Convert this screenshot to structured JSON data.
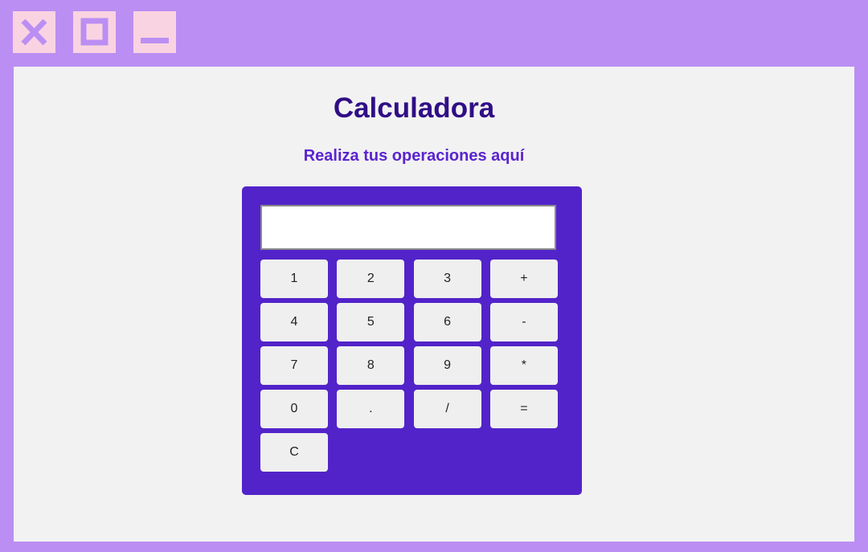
{
  "window": {
    "controls": [
      {
        "name": "close-button",
        "icon": "close-icon"
      },
      {
        "name": "maximize-button",
        "icon": "maximize-icon"
      },
      {
        "name": "minimize-button",
        "icon": "minimize-icon"
      }
    ]
  },
  "page": {
    "title": "Calculadora",
    "subtitle": "Realiza tus operaciones aquí"
  },
  "calculator": {
    "display_value": "",
    "keys": [
      "1",
      "2",
      "3",
      "+",
      "4",
      "5",
      "6",
      "-",
      "7",
      "8",
      "9",
      "*",
      "0",
      ".",
      "/",
      "=",
      "C"
    ]
  },
  "colors": {
    "frame": "#bb8ef3",
    "window_button": "#fad3e2",
    "content_bg": "#f2f2f2",
    "title": "#300d86",
    "subtitle": "#5a24d0",
    "calculator_bg": "#5223c9",
    "key_bg": "#efefef"
  }
}
